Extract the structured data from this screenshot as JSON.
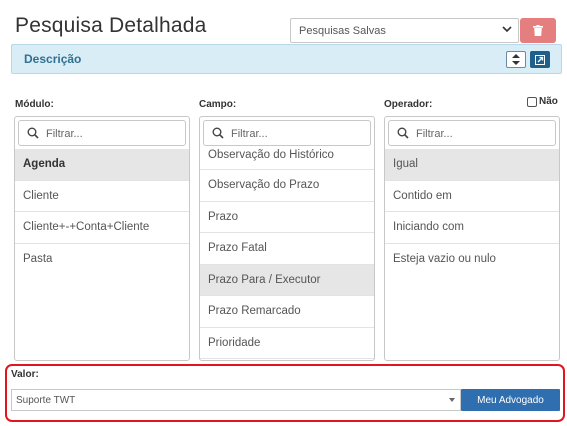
{
  "page_title": "Pesquisa Detalhada",
  "saved_searches": {
    "selected": "Pesquisas Salvas"
  },
  "description_bar": {
    "label": "Descrição"
  },
  "columns": {
    "modulo": {
      "label": "Módulo:",
      "filter_placeholder": "Filtrar...",
      "items": [
        "Agenda",
        "Cliente",
        "Cliente+-+Conta+Cliente",
        "Pasta"
      ]
    },
    "campo": {
      "label": "Campo:",
      "filter_placeholder": "Filtrar...",
      "items": [
        "Observação do Histórico",
        "Observação do Prazo",
        "Prazo",
        "Prazo Fatal",
        "Prazo Para / Executor",
        "Prazo Remarcado",
        "Prioridade"
      ]
    },
    "operador": {
      "label": "Operador:",
      "filter_placeholder": "Filtrar...",
      "items": [
        "Igual",
        "Contido em",
        "Iniciando com",
        "Esteja vazio ou nulo"
      ]
    }
  },
  "nao_checkbox": {
    "label": "Não",
    "checked": false
  },
  "valor": {
    "label": "Valor:",
    "selected": "Suporte TWT",
    "button_label": "Meu Advogado"
  },
  "colors": {
    "accent_blue": "#2f6fb0",
    "delete_red": "#e57f7f",
    "highlight_frame": "#e0151d",
    "info_bar": "#d9edf7"
  }
}
